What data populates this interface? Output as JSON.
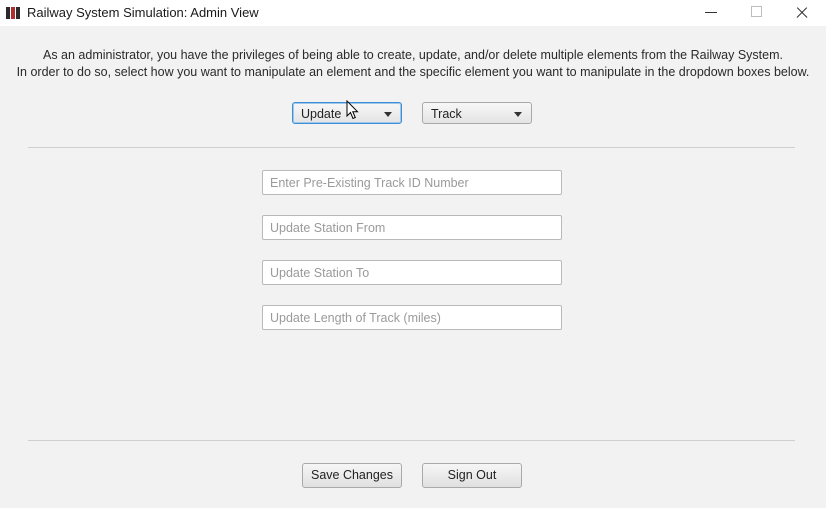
{
  "window": {
    "title": "Railway System Simulation: Admin View"
  },
  "instructions": {
    "line1": "As an administrator, you have the privileges of being able to create, update, and/or delete multiple elements from the Railway System.",
    "line2": "In order to do so, select how you want to manipulate an element and the specific element you want to manipulate in the dropdown boxes below."
  },
  "selectors": {
    "action": "Update",
    "element": "Track"
  },
  "form": {
    "track_id_placeholder": "Enter Pre-Existing Track ID Number",
    "station_from_placeholder": "Update Station From",
    "station_to_placeholder": "Update Station To",
    "length_placeholder": "Update Length of Track (miles)"
  },
  "buttons": {
    "save": "Save Changes",
    "sign_out": "Sign Out"
  }
}
